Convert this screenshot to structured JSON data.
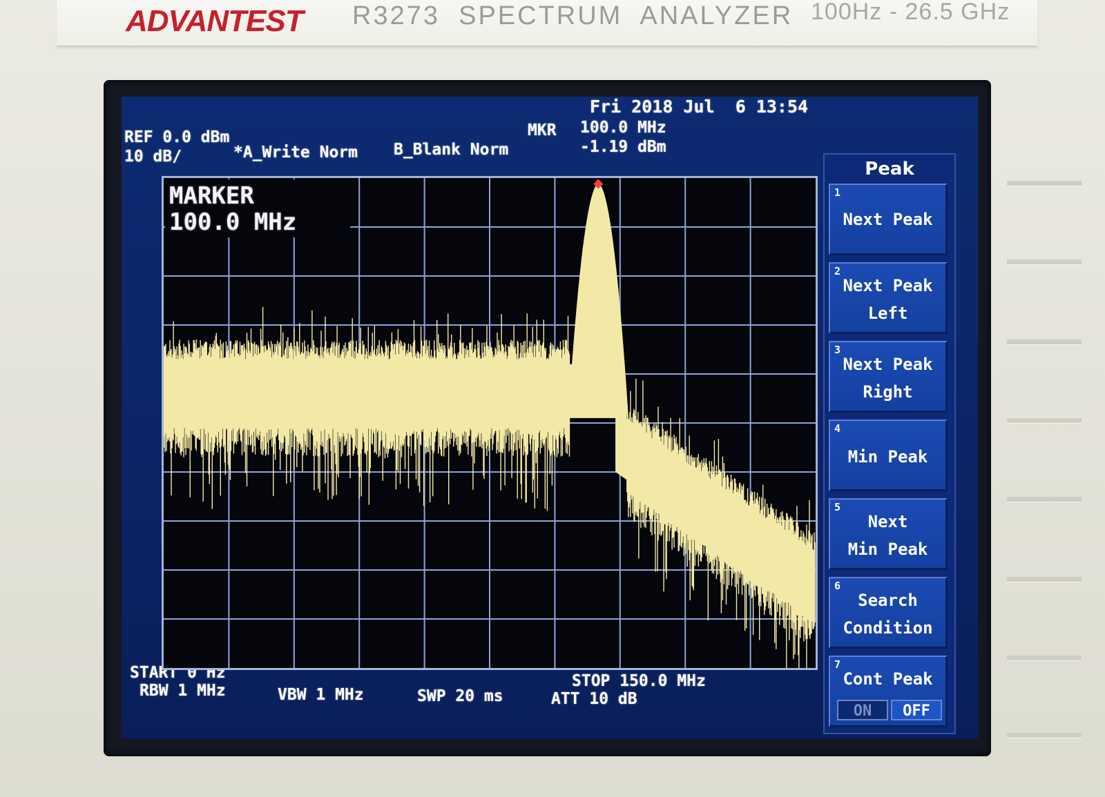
{
  "device": {
    "brand": "ADVANTEST",
    "model": "R3273  SPECTRUM  ANALYZER",
    "range": "100Hz - 26.5 GHz"
  },
  "header": {
    "datetime": "Fri 2018 Jul  6 13:54",
    "ref_level": "REF 0.0 dBm",
    "scale": "10 dB/",
    "trace_a": "*A_Write Norm",
    "trace_b": "B_Blank Norm",
    "mkr_label": "MKR",
    "mkr_freq": "100.0 MHz",
    "mkr_level": "-1.19 dBm"
  },
  "marker_box": {
    "label": "MARKER",
    "value": "100.0 MHz"
  },
  "footer": {
    "start": "START 0 Hz",
    "stop": "STOP 150.0 MHz",
    "rbw": "RBW 1 MHz",
    "vbw": "VBW 1 MHz",
    "swp": "SWP 20 ms",
    "att": "ATT 10 dB"
  },
  "menu": {
    "title": "Peak",
    "keys": [
      {
        "num": "1",
        "line1": "Next Peak",
        "line2": ""
      },
      {
        "num": "2",
        "line1": "Next Peak",
        "line2": "Left"
      },
      {
        "num": "3",
        "line1": "Next Peak",
        "line2": "Right"
      },
      {
        "num": "4",
        "line1": "Min Peak",
        "line2": ""
      },
      {
        "num": "5",
        "line1": "Next",
        "line2": "Min Peak"
      },
      {
        "num": "6",
        "line1": "Search",
        "line2": "Condition"
      },
      {
        "num": "7",
        "line1": "Cont Peak",
        "line2": ""
      }
    ],
    "toggle_on": "ON",
    "toggle_off": "OFF",
    "toggle_state": "OFF"
  },
  "colors": {
    "trace": "#f2e9a6",
    "grid": "#8ea4d8",
    "marker": "#ff3b3b",
    "screen_bg": "#0d2b72",
    "brand": "#c7202c"
  },
  "chart_data": {
    "type": "line",
    "xlim": [
      0,
      150
    ],
    "ylim": [
      -100,
      0
    ],
    "x_unit": "MHz",
    "y_unit": "dBm",
    "grid": true,
    "peak": {
      "x": 100.0,
      "y": -1.19
    },
    "noise_floor_band": [
      [
        0,
        -40,
        -55
      ],
      [
        95,
        -40,
        -55
      ],
      [
        105,
        -45,
        -55
      ],
      [
        150,
        -75,
        -90
      ]
    ],
    "series": [
      {
        "values": []
      }
    ]
  }
}
